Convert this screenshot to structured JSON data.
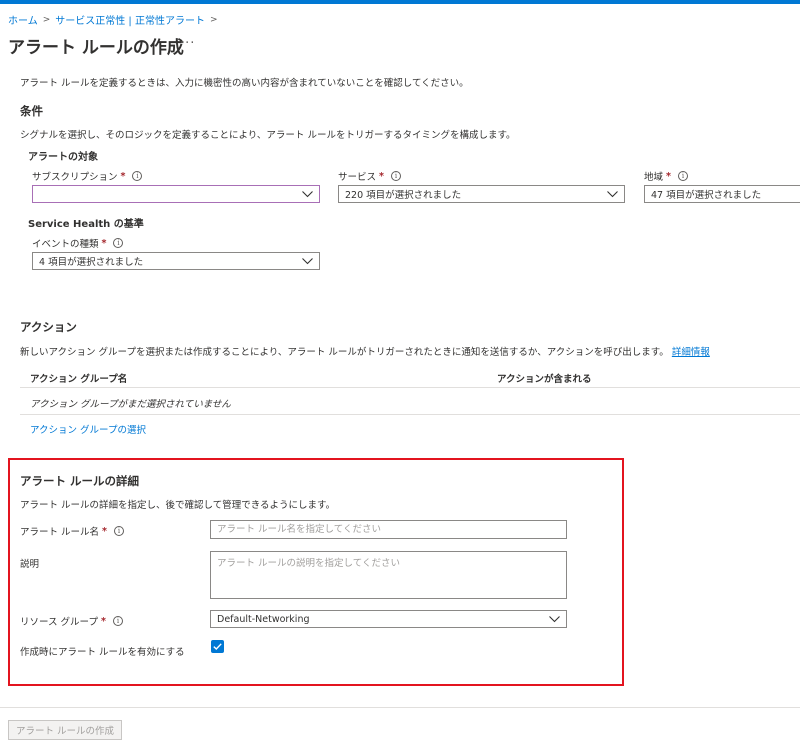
{
  "breadcrumb": [
    "ホーム",
    "サービス正常性 | 正常性アラート"
  ],
  "page_title": "アラート ルールの作成",
  "more_label": "···",
  "intro": "アラート ルールを定義するときは、入力に機密性の高い内容が含まれていないことを確認してください。",
  "conditions": {
    "heading": "条件",
    "description": "シグナルを選択し、そのロジックを定義することにより、アラート ルールをトリガーするタイミングを構成します。",
    "target_heading": "アラートの対象",
    "subscription": {
      "label": "サブスクリプション",
      "required": "*",
      "value": ""
    },
    "service": {
      "label": "サービス",
      "required": "*",
      "value": "220 項目が選択されました"
    },
    "region": {
      "label": "地域",
      "required": "*",
      "value": "47 項目が選択されました"
    },
    "criteria_heading": "Service Health の基準",
    "event_type": {
      "label": "イベントの種類",
      "required": "*",
      "value": "4 項目が選択されました"
    }
  },
  "actions": {
    "heading": "アクション",
    "description": "新しいアクション グループを選択または作成することにより、アラート ルールがトリガーされたときに通知を送信するか、アクションを呼び出します。",
    "learn_more": "詳細情報",
    "columns": [
      "アクション グループ名",
      "アクションが含まれる"
    ],
    "empty_text": "アクション グループがまだ選択されていません",
    "select_link": "アクション グループの選択"
  },
  "details": {
    "heading": "アラート ルールの詳細",
    "description": "アラート ルールの詳細を指定し、後で確認して管理できるようにします。",
    "rule_name": {
      "label": "アラート ルール名",
      "required": "*",
      "placeholder": "アラート ルール名を指定してください"
    },
    "desc_field": {
      "label": "説明",
      "placeholder": "アラート ルールの説明を指定してください"
    },
    "resource_group": {
      "label": "リソース グループ",
      "required": "*",
      "value": "Default-Networking"
    },
    "enable": {
      "label": "作成時にアラート ルールを有効にする",
      "checked": true
    }
  },
  "create_button": "アラート ルールの作成",
  "colors": {
    "accent": "#0078d4",
    "highlight_border": "#e3141f",
    "required": "#a4262c"
  },
  "info_icon_glyph": "i"
}
